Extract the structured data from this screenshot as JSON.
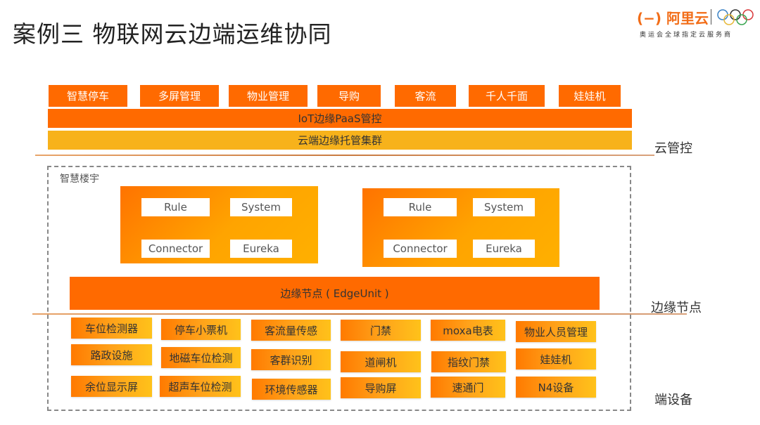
{
  "title": "案例三 物联网云边端运维协同",
  "logo": {
    "brand": "阿里云",
    "brand_icon": "aliyun-bracket-icon",
    "partner_icon": "olympic-rings-icon",
    "subtitle": "奥运会全球指定云服务商"
  },
  "colors": {
    "primary_orange": "#ff6a00",
    "amber": "#f7b21b",
    "divider": "#d08a52"
  },
  "cloud": {
    "apps": [
      "智慧停车",
      "多屏管理",
      "物业管理",
      "导购",
      "客流",
      "千人千面",
      "娃娃机"
    ],
    "paas_bar": "IoT边缘PaaS管控",
    "cluster_bar": "云端边缘托管集群",
    "layer_label": "云管控"
  },
  "edge": {
    "zone_label": "智慧楼宇",
    "service_groups": [
      {
        "chips": [
          "Rule",
          "System",
          "Connector",
          "Eureka"
        ]
      },
      {
        "chips": [
          "Rule",
          "System",
          "Connector",
          "Eureka"
        ]
      }
    ],
    "edge_unit": "边缘节点 ( EdgeUnit )",
    "layer_label": "边缘节点"
  },
  "devices": {
    "columns": [
      [
        "车位检测器",
        "路政设施",
        "余位显示屏"
      ],
      [
        "停车小票机",
        "地磁车位检测",
        "超声车位检测"
      ],
      [
        "客流量传感",
        "客群识别",
        "环境传感器"
      ],
      [
        "门禁",
        "道闸机",
        "导购屏"
      ],
      [
        "moxa电表",
        "指纹门禁",
        "速通门"
      ],
      [
        "物业人员管理",
        "娃娃机",
        "N4设备"
      ]
    ],
    "layer_label": "端设备"
  }
}
